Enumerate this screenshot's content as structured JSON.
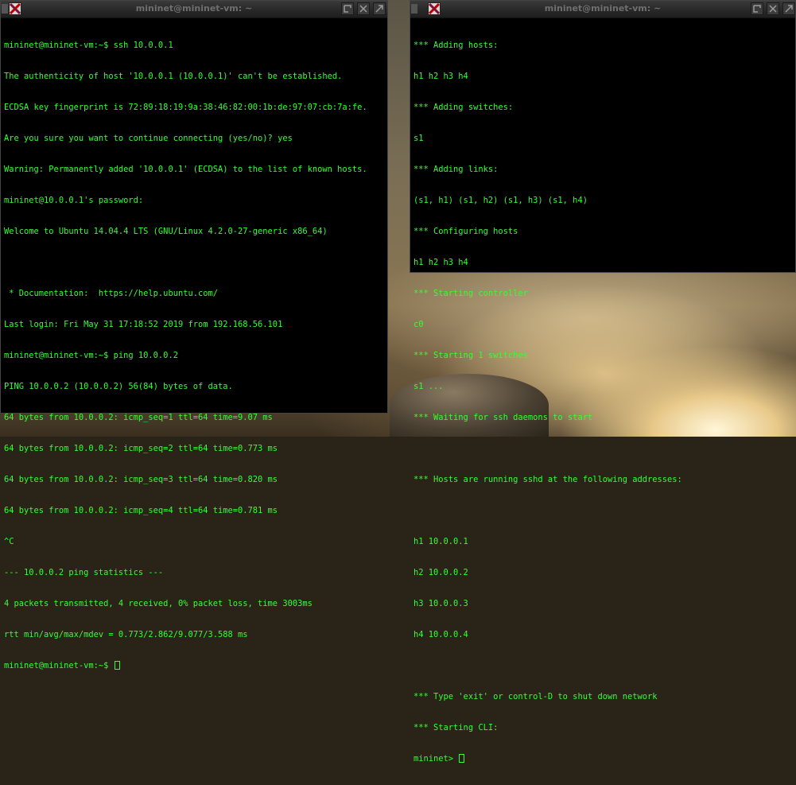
{
  "left_window": {
    "title": "mininet@mininet-vm: ~",
    "lines": [
      "mininet@mininet-vm:~$ ssh 10.0.0.1",
      "The authenticity of host '10.0.0.1 (10.0.0.1)' can't be established.",
      "ECDSA key fingerprint is 72:89:18:19:9a:38:46:82:00:1b:de:97:07:cb:7a:fe.",
      "Are you sure you want to continue connecting (yes/no)? yes",
      "Warning: Permanently added '10.0.0.1' (ECDSA) to the list of known hosts.",
      "mininet@10.0.0.1's password:",
      "Welcome to Ubuntu 14.04.4 LTS (GNU/Linux 4.2.0-27-generic x86_64)",
      "",
      " * Documentation:  https://help.ubuntu.com/",
      "Last login: Fri May 31 17:18:52 2019 from 192.168.56.101",
      "mininet@mininet-vm:~$ ping 10.0.0.2",
      "PING 10.0.0.2 (10.0.0.2) 56(84) bytes of data.",
      "64 bytes from 10.0.0.2: icmp_seq=1 ttl=64 time=9.07 ms",
      "64 bytes from 10.0.0.2: icmp_seq=2 ttl=64 time=0.773 ms",
      "64 bytes from 10.0.0.2: icmp_seq=3 ttl=64 time=0.820 ms",
      "64 bytes from 10.0.0.2: icmp_seq=4 ttl=64 time=0.781 ms",
      "^C",
      "--- 10.0.0.2 ping statistics ---",
      "4 packets transmitted, 4 received, 0% packet loss, time 3003ms",
      "rtt min/avg/max/mdev = 0.773/2.862/9.077/3.588 ms"
    ],
    "prompt": "mininet@mininet-vm:~$ "
  },
  "right_window": {
    "title": "mininet@mininet-vm: ~",
    "lines": [
      "*** Adding hosts:",
      "h1 h2 h3 h4",
      "*** Adding switches:",
      "s1",
      "*** Adding links:",
      "(s1, h1) (s1, h2) (s1, h3) (s1, h4)",
      "*** Configuring hosts",
      "h1 h2 h3 h4",
      "*** Starting controller",
      "c0",
      "*** Starting 1 switches",
      "s1 ...",
      "*** Waiting for ssh daemons to start",
      "",
      "*** Hosts are running sshd at the following addresses:",
      "",
      "h1 10.0.0.1",
      "h2 10.0.0.2",
      "h3 10.0.0.3",
      "h4 10.0.0.4",
      "",
      "*** Type 'exit' or control-D to shut down network",
      "*** Starting CLI:"
    ],
    "prompt": "mininet> "
  },
  "colors": {
    "terminal_text": "#33ff33",
    "terminal_bg": "#000000"
  },
  "icons": [
    "x-logo-icon",
    "shade-icon",
    "minimize-icon",
    "maximize-icon"
  ]
}
